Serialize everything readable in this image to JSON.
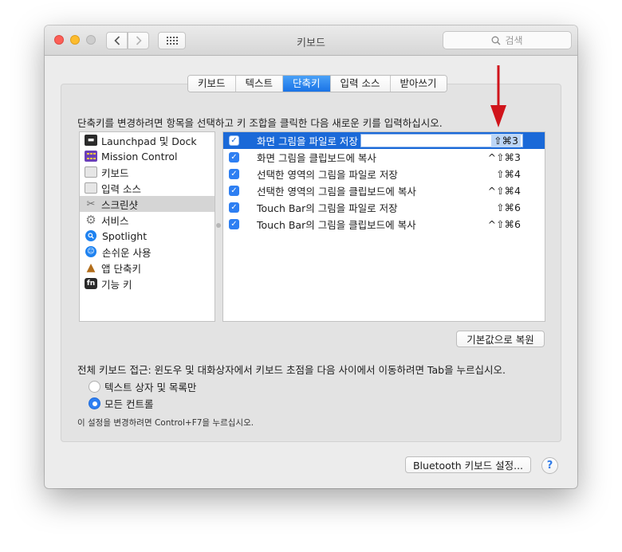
{
  "window": {
    "title": "키보드"
  },
  "search": {
    "placeholder": "검색"
  },
  "tabs": [
    {
      "label": "키보드",
      "active": false
    },
    {
      "label": "텍스트",
      "active": false
    },
    {
      "label": "단축키",
      "active": true
    },
    {
      "label": "입력 소스",
      "active": false
    },
    {
      "label": "받아쓰기",
      "active": false
    }
  ],
  "instruction": "단축키를 변경하려면 항목을 선택하고 키 조합을 클릭한 다음 새로운 키를 입력하십시오.",
  "categories": [
    {
      "label": "Launchpad 및 Dock",
      "icon": "launchpad-icon",
      "selected": false
    },
    {
      "label": "Mission Control",
      "icon": "mission-control-icon",
      "selected": false
    },
    {
      "label": "키보드",
      "icon": "keyboard-icon",
      "selected": false
    },
    {
      "label": "입력 소스",
      "icon": "input-source-icon",
      "selected": false
    },
    {
      "label": "스크린샷",
      "icon": "screenshot-icon",
      "selected": true
    },
    {
      "label": "서비스",
      "icon": "gear-icon",
      "selected": false
    },
    {
      "label": "Spotlight",
      "icon": "spotlight-icon",
      "selected": false
    },
    {
      "label": "손쉬운 사용",
      "icon": "accessibility-icon",
      "selected": false
    },
    {
      "label": "앱 단축키",
      "icon": "app-shortcuts-icon",
      "selected": false
    },
    {
      "label": "기능 키",
      "icon": "fn-key-icon",
      "selected": false
    }
  ],
  "shortcuts": [
    {
      "label": "화면 그림을 파일로 저장",
      "keys": "⇧⌘3",
      "checked": true,
      "selected": true
    },
    {
      "label": "화면 그림을 클립보드에 복사",
      "keys": "^⇧⌘3",
      "checked": true,
      "selected": false
    },
    {
      "label": "선택한 영역의 그림을 파일로 저장",
      "keys": "⇧⌘4",
      "checked": true,
      "selected": false
    },
    {
      "label": "선택한 영역의 그림을 클립보드에 복사",
      "keys": "^⇧⌘4",
      "checked": true,
      "selected": false
    },
    {
      "label": "Touch Bar의 그림을 파일로 저장",
      "keys": "⇧⌘6",
      "checked": true,
      "selected": false
    },
    {
      "label": "Touch Bar의 그림을 클립보드에 복사",
      "keys": "^⇧⌘6",
      "checked": true,
      "selected": false
    }
  ],
  "reset_button": "기본값으로 복원",
  "full_keyboard_access": {
    "label": "전체 키보드 접근: 윈도우 및 대화상자에서 키보드 초점을 다음 사이에서 이동하려면 Tab을 누르십시오.",
    "options": [
      {
        "label": "텍스트 상자 및 목록만",
        "selected": false
      },
      {
        "label": "모든 컨트롤",
        "selected": true
      }
    ],
    "note": "이 설정을 변경하려면 Control+F7을 누르십시오."
  },
  "bluetooth_button": "Bluetooth 키보드 설정...",
  "help_button": "?",
  "colors": {
    "accent": "#1a69d8",
    "annotation_arrow": "#d0141b"
  }
}
